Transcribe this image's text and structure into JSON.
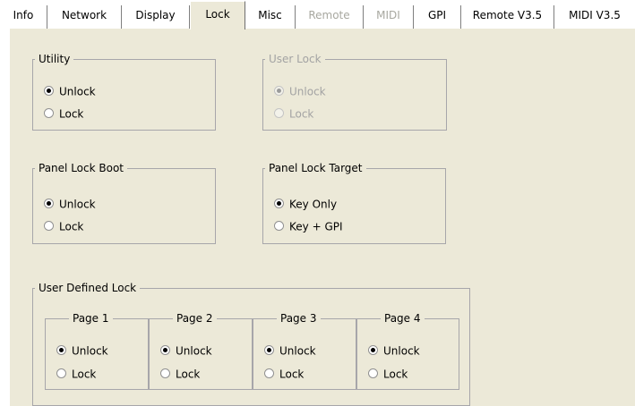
{
  "tabs": [
    {
      "label": "Info",
      "state": "normal"
    },
    {
      "label": "Network",
      "state": "normal"
    },
    {
      "label": "Display",
      "state": "normal"
    },
    {
      "label": "Lock",
      "state": "active"
    },
    {
      "label": "Misc",
      "state": "normal"
    },
    {
      "label": "Remote",
      "state": "disabled"
    },
    {
      "label": "MIDI",
      "state": "disabled"
    },
    {
      "label": "GPI",
      "state": "normal"
    },
    {
      "label": "Remote V3.5",
      "state": "normal"
    },
    {
      "label": "MIDI V3.5",
      "state": "normal"
    }
  ],
  "groups": {
    "utility": {
      "title": "Utility",
      "options": [
        "Unlock",
        "Lock"
      ],
      "selected": "Unlock"
    },
    "user_lock": {
      "title": "User Lock",
      "options": [
        "Unlock",
        "Lock"
      ],
      "selected": "Unlock",
      "enabled": false
    },
    "panel_lock_boot": {
      "title": "Panel Lock Boot",
      "options": [
        "Unlock",
        "Lock"
      ],
      "selected": "Unlock"
    },
    "panel_lock_target": {
      "title": "Panel Lock Target",
      "options": [
        "Key Only",
        "Key + GPI"
      ],
      "selected": "Key Only"
    },
    "user_defined_lock": {
      "title": "User Defined Lock",
      "pages": [
        {
          "title": "Page 1",
          "options": [
            "Unlock",
            "Lock"
          ],
          "selected": "Unlock"
        },
        {
          "title": "Page 2",
          "options": [
            "Unlock",
            "Lock"
          ],
          "selected": "Unlock"
        },
        {
          "title": "Page 3",
          "options": [
            "Unlock",
            "Lock"
          ],
          "selected": "Unlock"
        },
        {
          "title": "Page 4",
          "options": [
            "Unlock",
            "Lock"
          ],
          "selected": "Unlock"
        }
      ]
    }
  },
  "colors": {
    "panel_bg": "#ece9d8",
    "group_border": "#a7a6aa",
    "disabled_text": "#a3a3a3"
  }
}
